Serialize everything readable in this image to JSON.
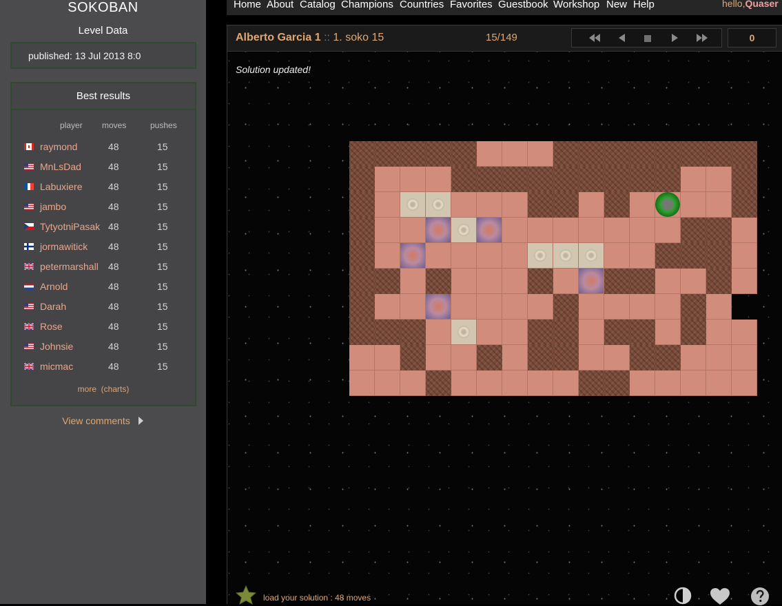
{
  "sidebar": {
    "title": "SOKOBAN",
    "level_data_heading": "Level Data",
    "published_label": "published:",
    "published_value": "13 Jul 2013 8:0",
    "best_results": {
      "heading": "Best results",
      "columns": [
        "player",
        "moves",
        "pushes"
      ],
      "rows": [
        {
          "flag": "canada",
          "player": "raymond",
          "moves": "48",
          "pushes": "15"
        },
        {
          "flag": "usa",
          "player": "MnLsDad",
          "moves": "48",
          "pushes": "15"
        },
        {
          "flag": "france",
          "player": "Labuxiere",
          "moves": "48",
          "pushes": "15"
        },
        {
          "flag": "usa",
          "player": "jambo",
          "moves": "48",
          "pushes": "15"
        },
        {
          "flag": "czech",
          "player": "TytyotniPasak",
          "moves": "48",
          "pushes": "15"
        },
        {
          "flag": "finland",
          "player": "jormawitick",
          "moves": "48",
          "pushes": "15"
        },
        {
          "flag": "uk",
          "player": "petermarshall",
          "moves": "48",
          "pushes": "15"
        },
        {
          "flag": "netherlands",
          "player": "Arnold",
          "moves": "48",
          "pushes": "15"
        },
        {
          "flag": "usa",
          "player": "Darah",
          "moves": "48",
          "pushes": "15"
        },
        {
          "flag": "uk",
          "player": "Rose",
          "moves": "48",
          "pushes": "15"
        },
        {
          "flag": "usa",
          "player": "Johnsie",
          "moves": "48",
          "pushes": "15"
        },
        {
          "flag": "uk",
          "player": "micmac",
          "moves": "48",
          "pushes": "15"
        }
      ],
      "more_label": "more",
      "charts_label": "(charts)"
    },
    "view_comments_label": "View comments"
  },
  "nav": {
    "items": [
      "Home",
      "About",
      "Catalog",
      "Champions",
      "Countries",
      "Favorites",
      "Guestbook",
      "Workshop",
      "New",
      "Help"
    ],
    "hello_label": "hello,",
    "user_name": "Quaser"
  },
  "level": {
    "author": "Alberto Garcia 1",
    "separator": "::",
    "name": "1. soko 15",
    "counter": "15/149",
    "moves_count": "0",
    "status": "Solution updated!",
    "controls": [
      "first-icon",
      "prev-icon",
      "stop-icon",
      "next-icon",
      "last-icon"
    ],
    "map": [
      "#####   ########",
      "#   #########  #",
      "# ..   ## # @  #",
      "#  $.$       ## ",
      "# *    ...  ### ",
      "## #   # $##  # ",
      "#  $    #    # ",
      "### .  ## ## #  ",
      "  #  # ##  ##   ",
      "   #     ##     "
    ]
  },
  "bottom": {
    "load_solution_label": "load your solution : 48 moves",
    "icons": [
      "star-icon",
      "contrast-icon",
      "heart-icon",
      "help-icon"
    ]
  },
  "colors": {
    "accent": "#e0a772",
    "sidebar_bg": "#4b4b4d",
    "panel_border": "#2f4a2f",
    "wall": "#7a4a38",
    "floor": "#d18c7c",
    "player": "#2fa32f"
  }
}
